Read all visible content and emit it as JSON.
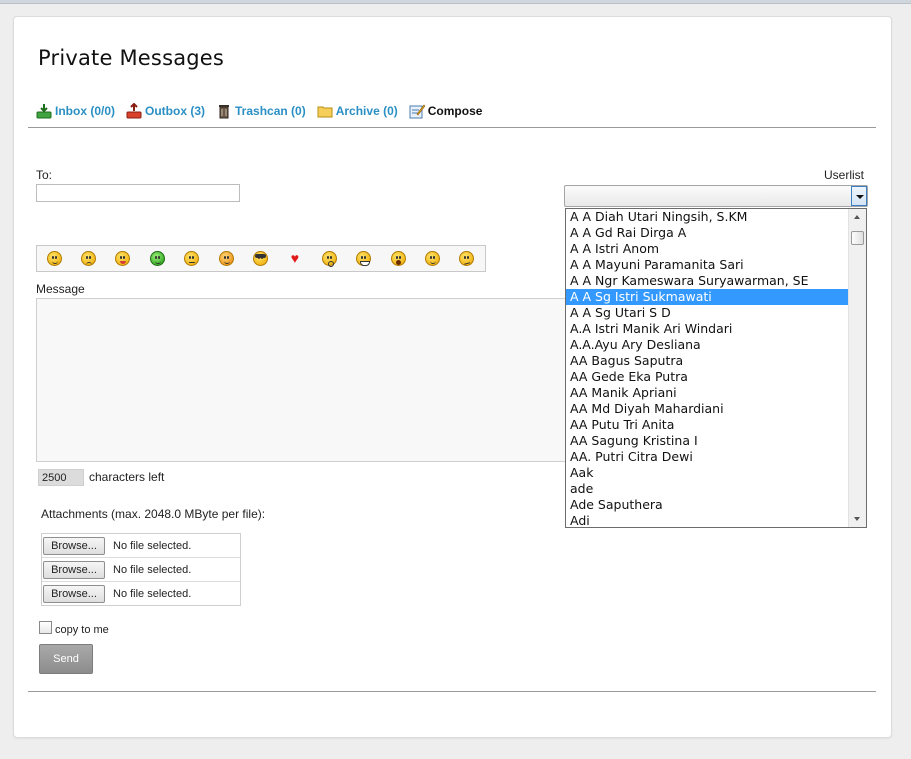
{
  "page": {
    "title": "Private Messages"
  },
  "tabs": [
    {
      "label": "Inbox (0/0)",
      "icon": "inbox-icon"
    },
    {
      "label": "Outbox (3)",
      "icon": "outbox-icon"
    },
    {
      "label": "Trashcan (0)",
      "icon": "trashcan-icon"
    },
    {
      "label": "Archive (0)",
      "icon": "archive-folder-icon"
    },
    {
      "label": "Compose",
      "icon": "compose-icon"
    }
  ],
  "form": {
    "to_label": "To:",
    "to_value": "",
    "userlist_label": "Userlist",
    "userlist_selected": "",
    "message_label": "Message",
    "chars_left_value": "2500",
    "chars_left_label": "characters left",
    "attachments_label": "Attachments (max. 2048.0 MByte per file):",
    "browse_label": "Browse...",
    "no_file_label": "No file selected.",
    "copy_to_me_label": "copy to me",
    "send_label": "Send"
  },
  "smileys": [
    "smile",
    "sad",
    "tongue",
    "sick",
    "angry",
    "blush",
    "cool",
    "heart",
    "surprised",
    "grin",
    "shocked",
    "wink",
    "confused"
  ],
  "userlist": {
    "options": [
      "A A Diah Utari Ningsih, S.KM",
      "A A Gd Rai Dirga A",
      "A A Istri Anom",
      "A A Mayuni Paramanita Sari",
      "A A Ngr Kameswara Suryawarman, SE",
      "A A Sg Istri Sukmawati",
      "A A Sg Utari S D",
      "A.A Istri Manik Ari Windari",
      "A.A.Ayu Ary Desliana",
      "AA Bagus Saputra",
      "AA Gede Eka Putra",
      "AA Manik Apriani",
      "AA Md Diyah Mahardiani",
      "AA Putu Tri Anita",
      "AA Sagung Kristina I",
      "AA. Putri Citra Dewi",
      "Aak",
      "ade",
      "Ade Saputhera",
      "Adi"
    ],
    "highlighted_index": 5
  },
  "colors": {
    "link": "#2a8fc4",
    "highlight": "#3399ff"
  }
}
